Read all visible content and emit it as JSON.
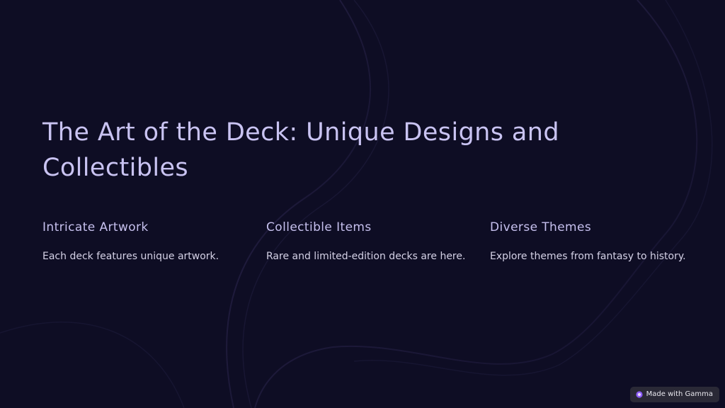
{
  "slide": {
    "title": "The Art of the Deck: Unique Designs and Collectibles",
    "columns": [
      {
        "heading": "Intricate Artwork",
        "text": "Each deck features unique artwork."
      },
      {
        "heading": "Collectible Items",
        "text": "Rare and limited-edition decks are here."
      },
      {
        "heading": "Diverse Themes",
        "text": "Explore themes from fantasy to history."
      }
    ]
  },
  "badge": {
    "label": "Made with Gamma",
    "icon": "gamma-logo-icon"
  },
  "colors": {
    "background": "#0e0d24",
    "title": "#c9c3f2",
    "body_text": "#d4d1e6",
    "badge_background": "#2a2936",
    "accent": "#8b5cf6"
  }
}
